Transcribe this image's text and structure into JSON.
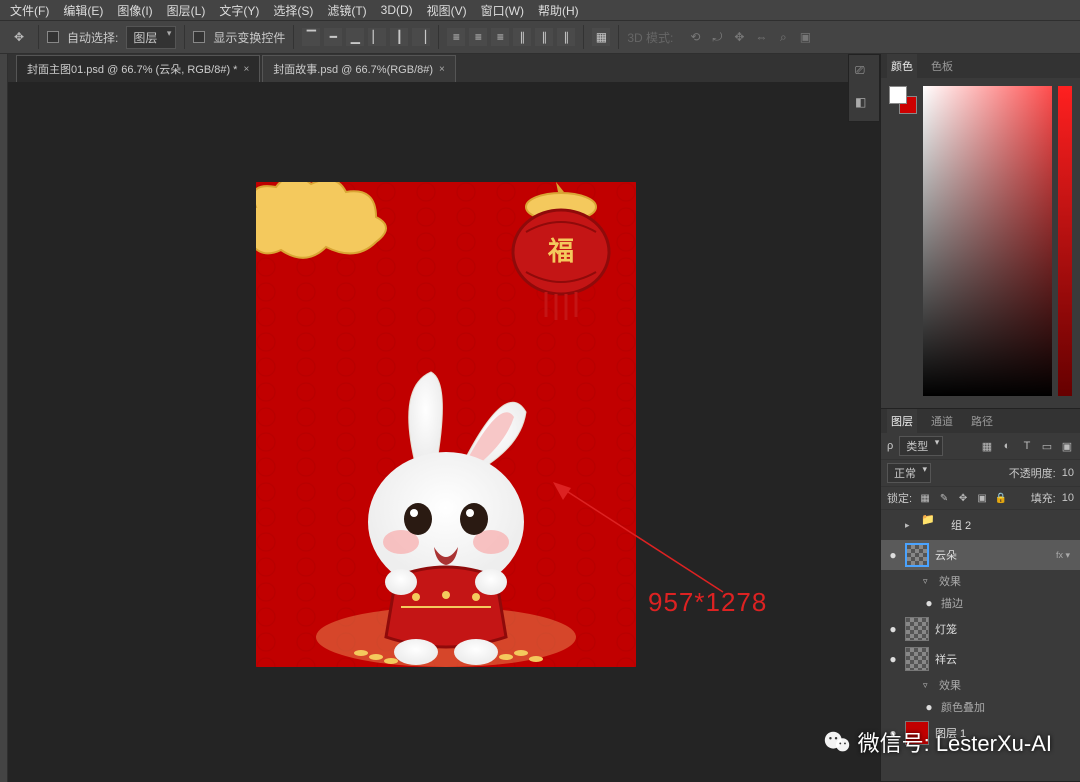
{
  "menu": {
    "items": [
      "文件(F)",
      "编辑(E)",
      "图像(I)",
      "图层(L)",
      "文字(Y)",
      "选择(S)",
      "滤镜(T)",
      "3D(D)",
      "视图(V)",
      "窗口(W)",
      "帮助(H)"
    ]
  },
  "options": {
    "autoselect_label": "自动选择:",
    "autoselect_value": "图层",
    "show_transform": "显示变换控件",
    "mode3d_label": "3D 模式:"
  },
  "tabs": [
    {
      "label": "封面主图01.psd @ 66.7% (云朵, RGB/8#) *",
      "active": true
    },
    {
      "label": "封面故事.psd @ 66.7%(RGB/8#)",
      "active": false
    }
  ],
  "annotation": {
    "dimensions": "957*1278"
  },
  "color_panel": {
    "tabs": [
      "颜色",
      "色板"
    ],
    "active": 0
  },
  "layers_panel": {
    "tabs": [
      "图层",
      "通道",
      "路径"
    ],
    "active": 0,
    "filter_label": "类型",
    "blend_mode": "正常",
    "opacity_label": "不透明度:",
    "opacity_value": "10",
    "lock_label": "锁定:",
    "fill_label": "填充:",
    "fill_value": "10",
    "items": [
      {
        "type": "group",
        "name": "组 2",
        "eye": "",
        "indent": 0
      },
      {
        "type": "layer",
        "name": "云朵",
        "eye": "●",
        "selected": true,
        "fx": true,
        "indent": 0
      },
      {
        "type": "sub",
        "name": "效果",
        "indent": 1,
        "disclose": "▿"
      },
      {
        "type": "sub",
        "name": "描边",
        "indent": 2,
        "eye": "●"
      },
      {
        "type": "layer",
        "name": "灯笼",
        "eye": "●",
        "indent": 0
      },
      {
        "type": "layer",
        "name": "祥云",
        "eye": "●",
        "indent": 0
      },
      {
        "type": "sub",
        "name": "效果",
        "indent": 1,
        "disclose": "▿"
      },
      {
        "type": "sub",
        "name": "颜色叠加",
        "indent": 2,
        "eye": "●"
      },
      {
        "type": "layer",
        "name": "图层 1",
        "eye": "●",
        "indent": 0,
        "red": true
      }
    ]
  },
  "watermark": {
    "text": "微信号: LesterXu-AI"
  }
}
